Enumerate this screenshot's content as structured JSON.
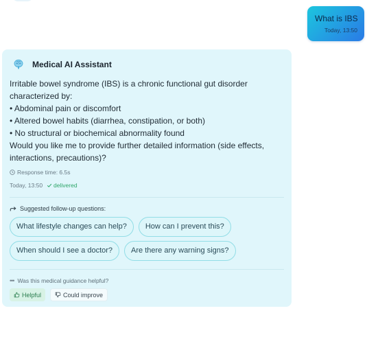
{
  "user_message": {
    "text": "What is IBS",
    "time": "Today, 13:50"
  },
  "assistant": {
    "name": "Medical AI Assistant",
    "avatar_icon": "brain-icon",
    "message_lines": [
      "Irritable bowel syndrome (IBS) is a chronic functional gut disorder",
      "characterized by:",
      "• Abdominal pain or discomfort",
      "• Altered bowel habits (diarrhea, constipation, or both)",
      "• No structural or biochemical abnormality found",
      "Would you like me to provide further detailed information (side effects,",
      "interactions, precautions)?"
    ],
    "response_time": "Response time: 6.5s",
    "time": "Today, 13:50",
    "status": "delivered"
  },
  "suggestions": {
    "title": "Suggested follow-up questions:",
    "items": [
      "What lifestyle changes can help?",
      "How can I prevent this?",
      "When should I see a doctor?",
      "Are there any warning signs?"
    ]
  },
  "feedback": {
    "question": "Was this medical guidance helpful?",
    "helpful_label": "Helpful",
    "improve_label": "Could improve"
  },
  "colors": {
    "card_bg": "#e0f6fb",
    "chip_border": "#92dde6",
    "user_gradient_start": "#1cc6de",
    "user_gradient_end": "#2a7ae6",
    "delivered": "#2fa66a"
  }
}
